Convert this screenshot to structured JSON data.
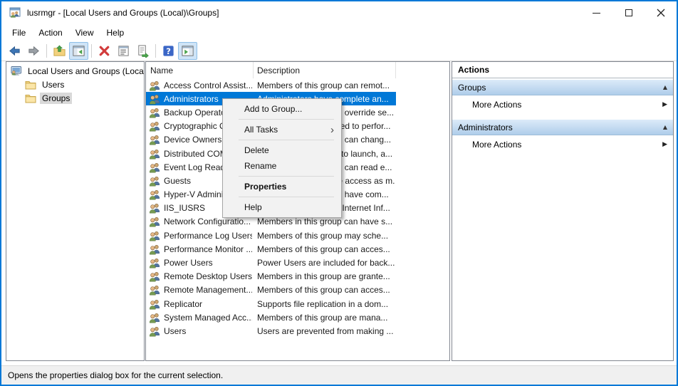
{
  "window": {
    "title": "lusrmgr - [Local Users and Groups (Local)\\Groups]",
    "app_icon": "local-users-and-groups-icon",
    "controls": [
      "minimize",
      "maximize",
      "close"
    ]
  },
  "menubar": {
    "items": [
      "File",
      "Action",
      "View",
      "Help"
    ]
  },
  "toolbar": {
    "buttons": [
      "back",
      "forward",
      "up-one-level",
      "show-console-tree",
      "delete",
      "properties",
      "export-list",
      "help",
      "show-action-pane"
    ],
    "toggled_on": [
      "show-console-tree",
      "show-action-pane"
    ]
  },
  "tree": {
    "root": {
      "label": "Local Users and Groups (Local)"
    },
    "children": [
      {
        "label": "Users",
        "selected": false
      },
      {
        "label": "Groups",
        "selected": true
      }
    ]
  },
  "list": {
    "columns": [
      "Name",
      "Description"
    ],
    "rows": [
      {
        "name": "Access Control Assist...",
        "description": "Members of this group can remot...",
        "selected": false
      },
      {
        "name": "Administrators",
        "description": "Administrators have complete an...",
        "selected": true
      },
      {
        "name": "Backup Operators",
        "description": "Backup Operators can override se...",
        "selected": false
      },
      {
        "name": "Cryptographic Operat...",
        "description": "Members are authorized to perfor...",
        "selected": false
      },
      {
        "name": "Device Owners",
        "description": "Members of this group can chang...",
        "selected": false
      },
      {
        "name": "Distributed COM Users",
        "description": "Members are allowed to launch, a...",
        "selected": false
      },
      {
        "name": "Event Log Readers",
        "description": "Members of this group can read e...",
        "selected": false
      },
      {
        "name": "Guests",
        "description": "Guests have the same access as m...",
        "selected": false
      },
      {
        "name": "Hyper-V Administrators",
        "description": "Members of this group have com...",
        "selected": false
      },
      {
        "name": "IIS_IUSRS",
        "description": "Built-in group used by Internet Inf...",
        "selected": false
      },
      {
        "name": "Network Configuratio...",
        "description": "Members in this group can have s...",
        "selected": false
      },
      {
        "name": "Performance Log Users",
        "description": "Members of this group may sche...",
        "selected": false
      },
      {
        "name": "Performance Monitor ...",
        "description": "Members of this group can acces...",
        "selected": false
      },
      {
        "name": "Power Users",
        "description": "Power Users are included for back...",
        "selected": false
      },
      {
        "name": "Remote Desktop Users",
        "description": "Members in this group are grante...",
        "selected": false
      },
      {
        "name": "Remote Management...",
        "description": "Members of this group can acces...",
        "selected": false
      },
      {
        "name": "Replicator",
        "description": "Supports file replication in a dom...",
        "selected": false
      },
      {
        "name": "System Managed Acc...",
        "description": "Members of this group are mana...",
        "selected": false
      },
      {
        "name": "Users",
        "description": "Users are prevented from making ...",
        "selected": false
      }
    ]
  },
  "context_menu": {
    "items": [
      {
        "type": "item",
        "label": "Add to Group..."
      },
      {
        "type": "separator"
      },
      {
        "type": "item",
        "label": "All Tasks",
        "submenu": true
      },
      {
        "type": "separator"
      },
      {
        "type": "item",
        "label": "Delete"
      },
      {
        "type": "item",
        "label": "Rename"
      },
      {
        "type": "separator"
      },
      {
        "type": "item",
        "label": "Properties",
        "bold": true
      },
      {
        "type": "separator"
      },
      {
        "type": "item",
        "label": "Help"
      }
    ]
  },
  "actions_pane": {
    "title": "Actions",
    "sections": [
      {
        "header": "Groups",
        "collapsed": false,
        "items": [
          "More Actions"
        ]
      },
      {
        "header": "Administrators",
        "collapsed": false,
        "items": [
          "More Actions"
        ]
      }
    ]
  },
  "statusbar": {
    "text": "Opens the properties dialog box for the current selection."
  },
  "colors": {
    "accent": "#0078d7",
    "selection_bg": "#0078d7",
    "selection_text": "#ffffff",
    "section_header_top": "#dcebf9",
    "section_header_bottom": "#afcdea",
    "menu_bg": "#f2f2f2",
    "statusbar_bg": "#f0f0f0",
    "tree_selected_bg": "#d9d9d9"
  }
}
